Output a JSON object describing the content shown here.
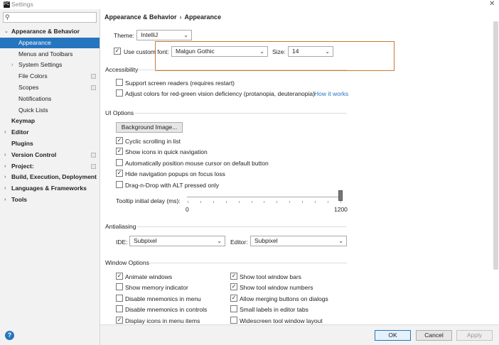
{
  "window": {
    "title": "Settings",
    "close_glyph": "✕"
  },
  "sidebar": {
    "search": {
      "value": "",
      "placeholder": ""
    },
    "items": [
      {
        "label": "Appearance & Behavior",
        "arrow": "⌄",
        "bold": true
      },
      {
        "label": "Appearance",
        "selected": true
      },
      {
        "label": "Menus and Toolbars"
      },
      {
        "label": "System Settings",
        "arrow": "›"
      },
      {
        "label": "File Colors"
      },
      {
        "label": "Scopes"
      },
      {
        "label": "Notifications"
      },
      {
        "label": "Quick Lists"
      },
      {
        "label": "Keymap",
        "bold": true
      },
      {
        "label": "Editor",
        "arrow": "›",
        "bold": true
      },
      {
        "label": "Plugins",
        "bold": true
      },
      {
        "label": "Version Control",
        "arrow": "›",
        "bold": true
      },
      {
        "label": "Project:",
        "arrow": "›",
        "bold": true
      },
      {
        "label": "Build, Execution, Deployment",
        "arrow": "›",
        "bold": true
      },
      {
        "label": "Languages & Frameworks",
        "arrow": "›",
        "bold": true
      },
      {
        "label": "Tools",
        "arrow": "›",
        "bold": true
      }
    ]
  },
  "breadcrumb": {
    "parent": "Appearance & Behavior",
    "separator": "›",
    "current": "Appearance"
  },
  "theme": {
    "label": "Theme:",
    "value": "IntelliJ"
  },
  "font": {
    "checkbox_label": "Use custom font:",
    "checked": true,
    "value": "Malgun Gothic",
    "size_label": "Size:",
    "size_value": "14"
  },
  "accessibility": {
    "title": "Accessibility",
    "screen_readers": "Support screen readers (requires restart)",
    "color_adjust": "Adjust colors for red-green vision deficiency (protanopia, deuteranopia)",
    "how_it_works": "How it works"
  },
  "ui_options": {
    "title": "UI Options",
    "background_button": "Background Image...",
    "options": [
      {
        "label": "Cyclic scrolling in list",
        "checked": true
      },
      {
        "label": "Show icons in quick navigation",
        "checked": true
      },
      {
        "label": "Automatically position mouse cursor on default button",
        "checked": false
      },
      {
        "label": "Hide navigation popups on focus loss",
        "checked": true
      },
      {
        "label": "Drag-n-Drop with ALT pressed only",
        "checked": false
      }
    ],
    "tooltip_label": "Tooltip initial delay (ms):",
    "tooltip_min": "0",
    "tooltip_max": "1200",
    "tooltip_value": 1200
  },
  "antialiasing": {
    "title": "Antialiasing",
    "ide_label": "IDE:",
    "ide_value": "Subpixel",
    "editor_label": "Editor:",
    "editor_value": "Subpixel"
  },
  "window_options": {
    "title": "Window Options",
    "left": [
      {
        "label": "Animate windows",
        "checked": true
      },
      {
        "label": "Show memory indicator",
        "checked": false
      },
      {
        "label": "Disable mnemonics in menu",
        "checked": false
      },
      {
        "label": "Disable mnemonics in controls",
        "checked": false
      },
      {
        "label": "Display icons in menu items",
        "checked": true
      }
    ],
    "right": [
      {
        "label": "Show tool window bars",
        "checked": true
      },
      {
        "label": "Show tool window numbers",
        "checked": true
      },
      {
        "label": "Allow merging buttons on dialogs",
        "checked": true
      },
      {
        "label": "Small labels in editor tabs",
        "checked": false
      },
      {
        "label": "Widescreen tool window layout",
        "checked": false
      }
    ]
  },
  "footer": {
    "ok": "OK",
    "cancel": "Cancel",
    "apply": "Apply",
    "help": "?"
  },
  "colors": {
    "accent": "#2675bf",
    "highlight": "#c97a35"
  }
}
